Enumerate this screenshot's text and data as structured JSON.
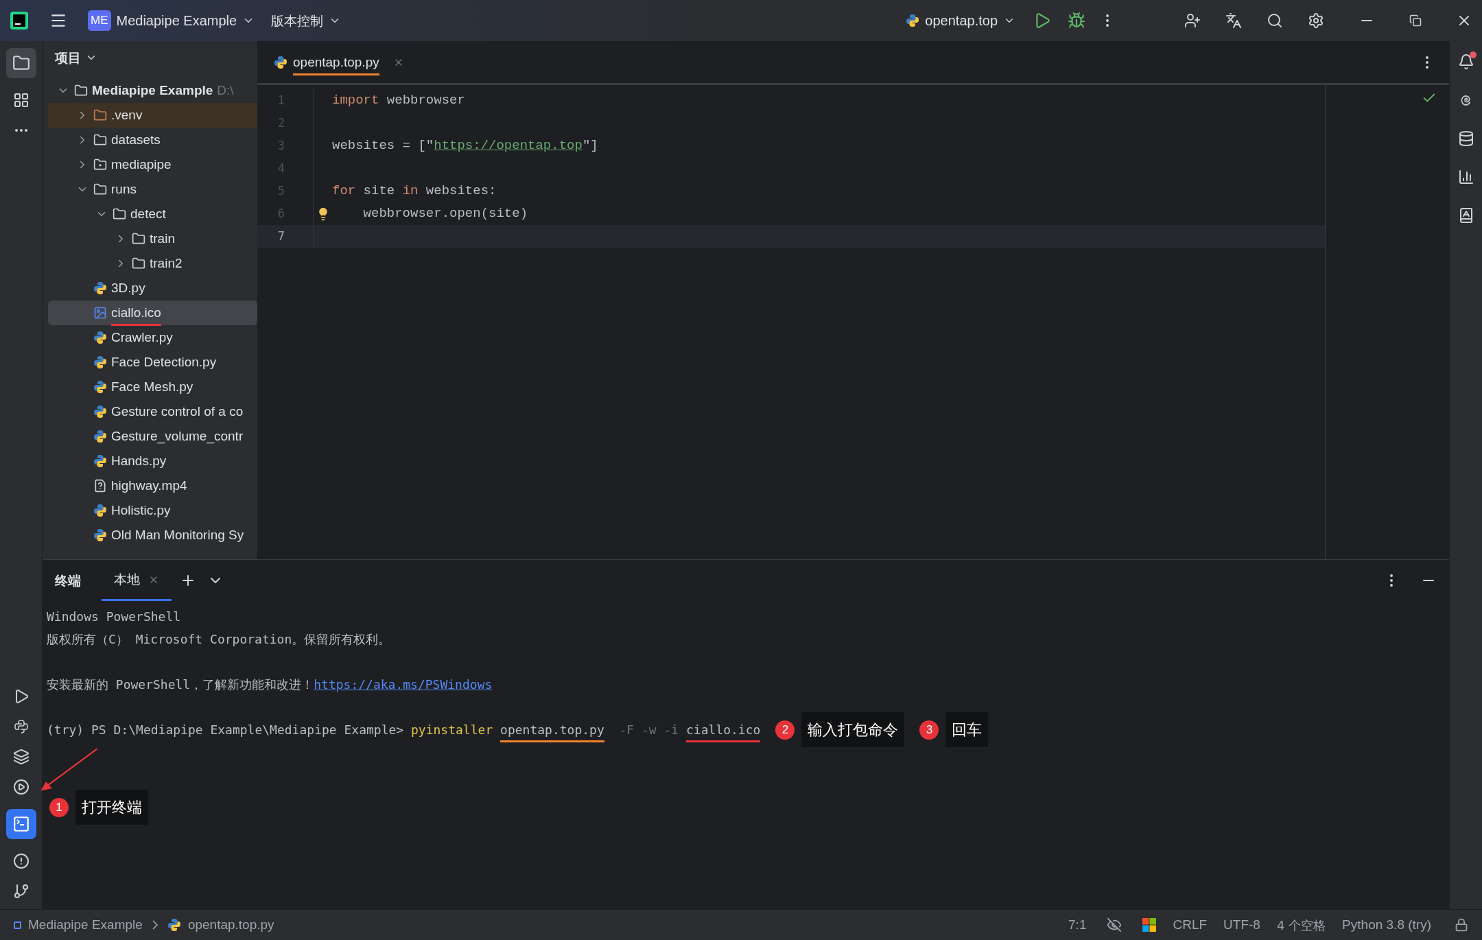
{
  "title_bar": {
    "project_badge": "ME",
    "project": "Mediapipe Example",
    "vcs": "版本控制",
    "run_config": "opentap.top"
  },
  "project_panel": {
    "title": "项目",
    "tree": [
      {
        "name": "Mediapipe Example",
        "hint": "D:\\",
        "kind": "folder",
        "expanded": true,
        "selected": false,
        "children": [
          {
            "name": ".venv",
            "kind": "excluded",
            "expanded": false,
            "selected": false
          },
          {
            "name": "datasets",
            "kind": "folder",
            "expanded": false,
            "selected": false
          },
          {
            "name": "mediapipe",
            "kind": "package",
            "expanded": false,
            "selected": false
          },
          {
            "name": "runs",
            "kind": "folder",
            "expanded": true,
            "selected": false,
            "children": [
              {
                "name": "detect",
                "kind": "folder",
                "expanded": true,
                "selected": false,
                "children": [
                  {
                    "name": "train",
                    "kind": "folder",
                    "expanded": false,
                    "selected": false
                  },
                  {
                    "name": "train2",
                    "kind": "folder",
                    "expanded": false,
                    "selected": false
                  }
                ]
              }
            ]
          },
          {
            "name": "3D.py",
            "kind": "python",
            "selected": false
          },
          {
            "name": "ciallo.ico",
            "kind": "image",
            "selected": true,
            "color": "#e8333a"
          },
          {
            "name": "Crawler.py",
            "kind": "python",
            "selected": false
          },
          {
            "name": "Face Detection.py",
            "kind": "python",
            "selected": false
          },
          {
            "name": "Face Mesh.py",
            "kind": "python",
            "selected": false
          },
          {
            "name": "Gesture control of a co",
            "kind": "python",
            "selected": false
          },
          {
            "name": "Gesture_volume_contr",
            "kind": "python",
            "selected": false
          },
          {
            "name": "Hands.py",
            "kind": "python",
            "selected": false
          },
          {
            "name": "highway.mp4",
            "kind": "unknown",
            "selected": false
          },
          {
            "name": "Holistic.py",
            "kind": "python",
            "selected": false
          },
          {
            "name": "Old Man Monitoring Sy",
            "kind": "python",
            "selected": false
          }
        ]
      }
    ]
  },
  "editor": {
    "tabs": [
      {
        "label": "opentap.top.py",
        "selected": true,
        "color": "#f0822e"
      }
    ],
    "lines": [
      {
        "number": "1",
        "current": false,
        "bulb": false,
        "tokens": [
          {
            "text": "import",
            "kind": "keyword"
          },
          {
            "text": " webbrowser",
            "kind": "plain"
          }
        ]
      },
      {
        "number": "2",
        "current": false,
        "bulb": false
      },
      {
        "number": "3",
        "current": false,
        "bulb": false,
        "tokens": [
          {
            "text": "websites = [\"",
            "kind": "plain"
          },
          {
            "text": "https://opentap.top",
            "kind": "link"
          },
          {
            "text": "\"]",
            "kind": "plain"
          }
        ]
      },
      {
        "number": "4",
        "current": false,
        "bulb": false
      },
      {
        "number": "5",
        "current": false,
        "bulb": false,
        "tokens": [
          {
            "text": "for",
            "kind": "keyword"
          },
          {
            "text": " site ",
            "kind": "plain"
          },
          {
            "text": "in",
            "kind": "keyword"
          },
          {
            "text": " websites:",
            "kind": "plain"
          }
        ]
      },
      {
        "number": "6",
        "current": false,
        "bulb": true,
        "tokens": [
          {
            "text": "    webbrowser.open(site)",
            "kind": "plain"
          }
        ]
      },
      {
        "number": "7",
        "current": true,
        "bulb": false
      }
    ]
  },
  "terminal": {
    "title": "终端",
    "tabs": [
      {
        "label": "本地",
        "selected": true
      }
    ],
    "blocks": [
      [
        [
          {
            "text": "Windows PowerShell",
            "kind": "plain"
          }
        ],
        [
          {
            "text": "版权所有（C） Microsoft Corporation。保留所有权利。",
            "kind": "plain"
          }
        ]
      ],
      [
        [
          {
            "text": "安装最新的 PowerShell，了解新功能和改进！",
            "kind": "plain"
          },
          {
            "text": "https://aka.ms/PSWindows",
            "kind": "link"
          }
        ]
      ],
      [
        [
          {
            "text": "(try) PS D:\\Mediapipe Example\\Mediapipe Example> ",
            "kind": "plain"
          },
          {
            "text": "pyinstaller ",
            "kind": "command"
          },
          {
            "text": "opentap.top.py",
            "kind": "plain",
            "color": "#f0822e"
          },
          {
            "text": "  -F -w -i ",
            "kind": "option"
          },
          {
            "text": "ciallo.ico",
            "kind": "plain",
            "color": "#e8333a"
          }
        ]
      ]
    ],
    "annotations": [
      {
        "number": "1",
        "label": "打开终端",
        "kind": "sidebar"
      },
      {
        "number": "2",
        "label": "输入打包命令",
        "kind": "inline"
      },
      {
        "number": "3",
        "label": "回车",
        "kind": "inline"
      }
    ]
  },
  "status_bar": {
    "breadcrumbs": [
      "Mediapipe Example",
      "opentap.top.py"
    ],
    "position": "7:1",
    "line_separator": "CRLF",
    "encoding": "UTF-8",
    "indent": "4 个空格",
    "interpreter": "Python 3.8 (try)"
  }
}
